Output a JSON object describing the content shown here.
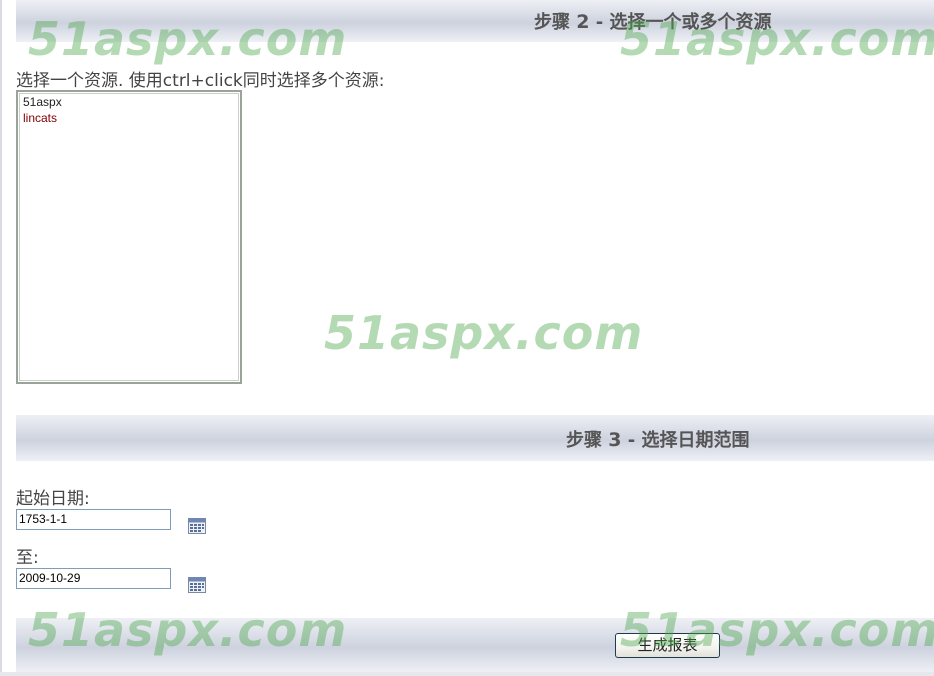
{
  "step2": {
    "prefix": "步骤",
    "number": "2",
    "suffix": "- 选择一个或多个资源"
  },
  "resources": {
    "instruction": "选择一个资源. 使用ctrl+click同时选择多个资源:",
    "options": [
      "51aspx",
      "lincats"
    ]
  },
  "step3": {
    "prefix": "步骤",
    "number": "3",
    "suffix": "- 选择日期范围"
  },
  "dates": {
    "start_label": "起始日期:",
    "start_value": "1753-1-1",
    "end_label": "至:",
    "end_value": "2009-10-29",
    "calendar_icon": "calendar-icon"
  },
  "actions": {
    "generate_label": "生成报表"
  },
  "watermark": {
    "text": "51aspx.com",
    "color": "#4ca84c"
  }
}
